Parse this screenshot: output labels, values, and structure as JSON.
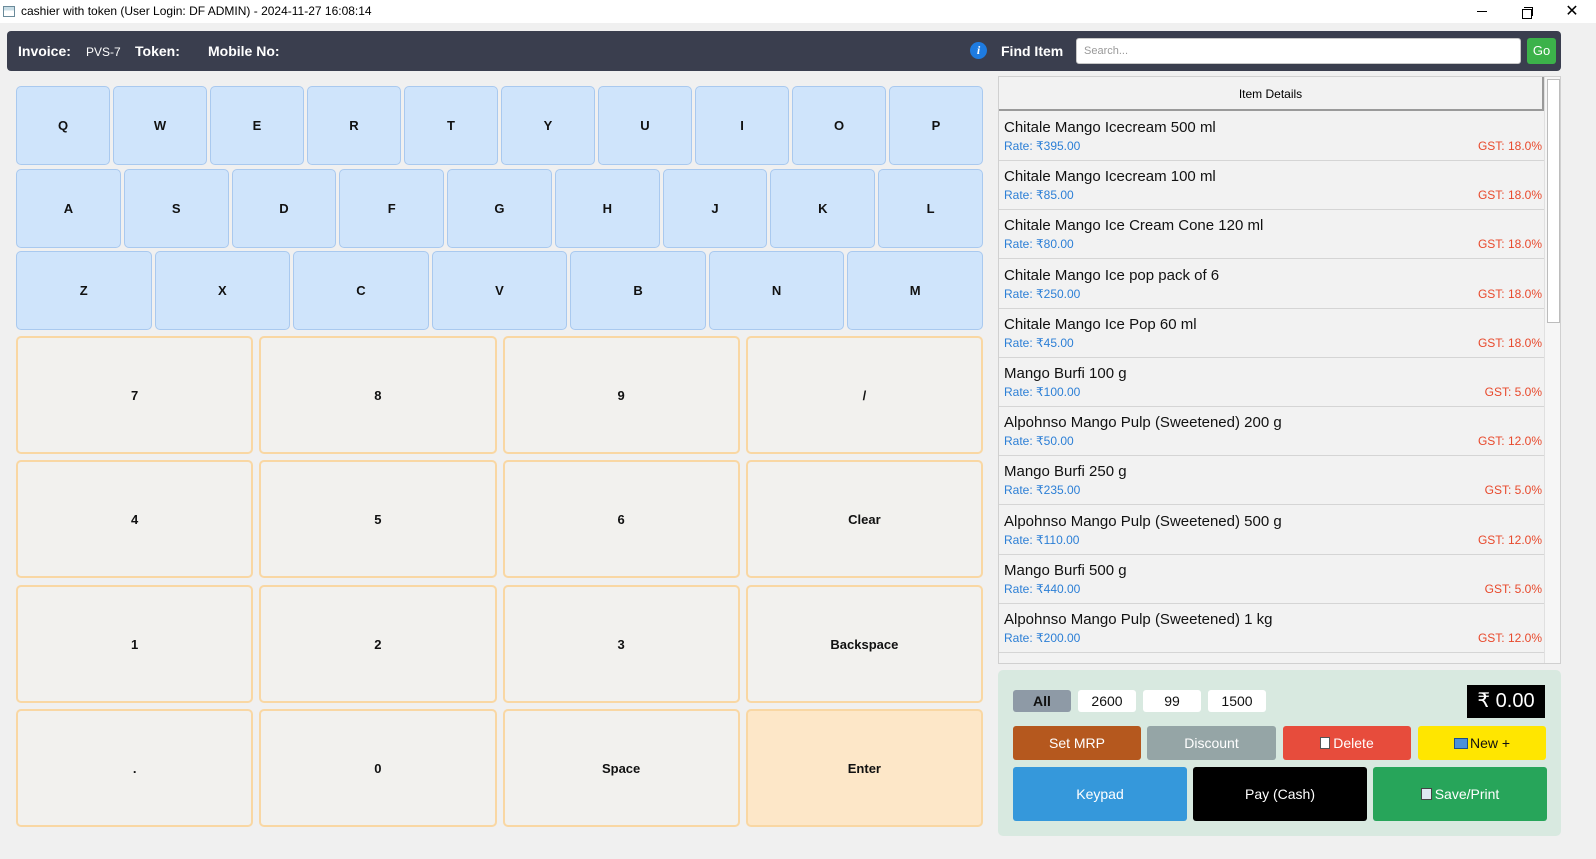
{
  "window": {
    "title": "cashier with token (User Login: DF ADMIN) - 2024-11-27 16:08:14"
  },
  "header": {
    "invoice_label": "Invoice:",
    "invoice_value": "PVS-7",
    "token_label": "Token:",
    "token_value": "",
    "mobile_label": "Mobile No:",
    "mobile_value": "",
    "info_icon": "i",
    "find_item_label": "Find Item",
    "search_placeholder": "Search...",
    "go_label": "Go"
  },
  "keyboard": {
    "row1": [
      "Q",
      "W",
      "E",
      "R",
      "T",
      "Y",
      "U",
      "I",
      "O",
      "P"
    ],
    "row2": [
      "A",
      "S",
      "D",
      "F",
      "G",
      "H",
      "J",
      "K",
      "L"
    ],
    "row3": [
      "Z",
      "X",
      "C",
      "V",
      "B",
      "N",
      "M"
    ],
    "numpad": [
      [
        "7",
        "8",
        "9",
        "/"
      ],
      [
        "4",
        "5",
        "6",
        "Clear"
      ],
      [
        "1",
        "2",
        "3",
        "Backspace"
      ],
      [
        ".",
        "0",
        "Space",
        "Enter"
      ]
    ]
  },
  "items_panel": {
    "header": "Item Details",
    "items": [
      {
        "name": "Chitale Mango Icecream 500 ml",
        "rate": "Rate: ₹395.00",
        "gst": "GST: 18.0%"
      },
      {
        "name": "Chitale Mango Icecream 100 ml",
        "rate": "Rate: ₹85.00",
        "gst": "GST: 18.0%"
      },
      {
        "name": "Chitale Mango Ice Cream Cone 120 ml",
        "rate": "Rate: ₹80.00",
        "gst": "GST: 18.0%"
      },
      {
        "name": "Chitale Mango Ice pop pack of 6",
        "rate": "Rate: ₹250.00",
        "gst": "GST: 18.0%"
      },
      {
        "name": "Chitale Mango Ice Pop 60 ml",
        "rate": "Rate: ₹45.00",
        "gst": "GST: 18.0%"
      },
      {
        "name": "Mango Burfi 100 g",
        "rate": "Rate: ₹100.00",
        "gst": "GST: 5.0%"
      },
      {
        "name": "Alpohnso Mango Pulp (Sweetened) 200 g",
        "rate": "Rate: ₹50.00",
        "gst": "GST: 12.0%"
      },
      {
        "name": "Mango Burfi 250 g",
        "rate": "Rate: ₹235.00",
        "gst": "GST: 5.0%"
      },
      {
        "name": "Alpohnso Mango Pulp (Sweetened) 500 g",
        "rate": "Rate: ₹110.00",
        "gst": "GST: 12.0%"
      },
      {
        "name": "Mango Burfi 500 g",
        "rate": "Rate: ₹440.00",
        "gst": "GST: 5.0%"
      },
      {
        "name": "Alpohnso Mango Pulp (Sweetened) 1 kg",
        "rate": "Rate: ₹200.00",
        "gst": "GST: 12.0%"
      }
    ]
  },
  "filters": [
    "All",
    "2600",
    "99",
    "1500"
  ],
  "total": "₹ 0.00",
  "actions": {
    "set_mrp": "Set MRP",
    "discount": "Discount",
    "delete": "Delete",
    "new": "New +",
    "keypad": "Keypad",
    "pay": "Pay (Cash)",
    "save_print": "Save/Print"
  },
  "colors": {
    "header_bg": "#3a3e4e",
    "alpha_key": "#cfe4fb",
    "num_key": "#f2f1ee",
    "enter_key": "#fde7c8",
    "rate": "#2c7fd6",
    "gst": "#e8492c",
    "set_mrp": "#b5581e",
    "discount": "#95a5a6",
    "delete": "#e74c3c",
    "new": "#ffe600",
    "keypad": "#3598db",
    "pay": "#000000",
    "save_print": "#27a55a",
    "go": "#3cb24a"
  }
}
